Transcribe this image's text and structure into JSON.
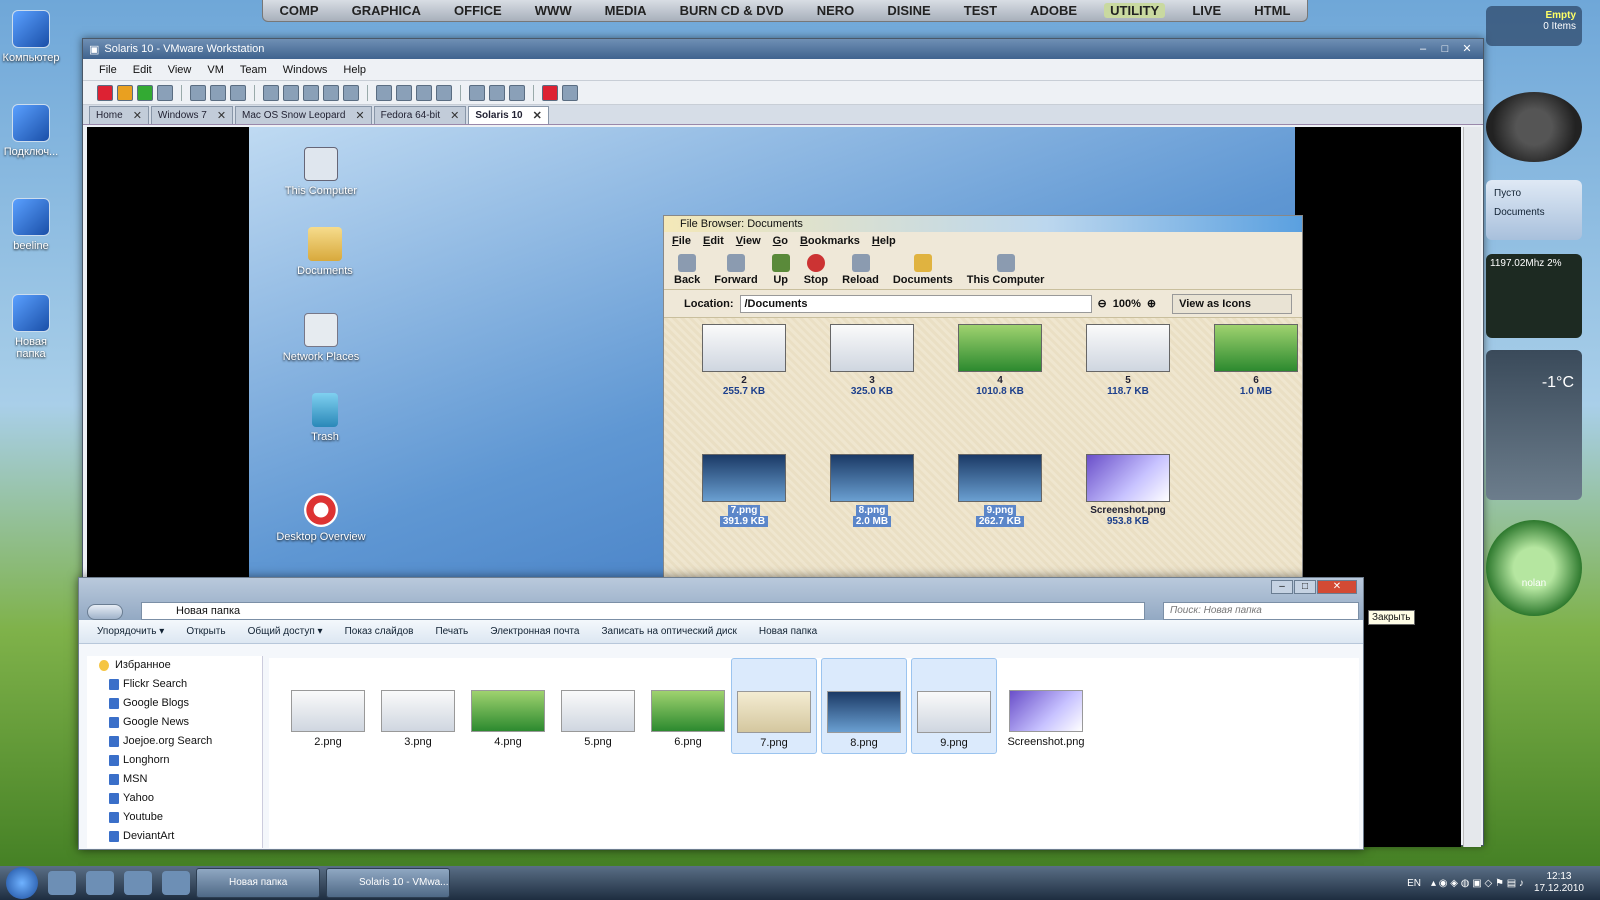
{
  "topbar": [
    "COMP",
    "GRAPHICA",
    "OFFICE",
    "WWW",
    "MEDIA",
    "BURN CD & DVD",
    "NERO",
    "DISINE",
    "TEST",
    "ADOBE",
    "UTILITY",
    "LIVE",
    "HTML"
  ],
  "desktop_icons": [
    "Компьютер",
    "Подключ...",
    "beeline",
    "Новая папка"
  ],
  "vmware": {
    "title": "Solaris 10 - VMware Workstation",
    "menu": [
      "File",
      "Edit",
      "View",
      "VM",
      "Team",
      "Windows",
      "Help"
    ],
    "tabs": [
      "Home",
      "Windows 7",
      "Mac OS Snow Leopard",
      "Fedora 64-bit",
      "Solaris 10"
    ]
  },
  "solaris": {
    "icons": [
      "This Computer",
      "Documents",
      "Network Places",
      "Trash",
      "Desktop Overview"
    ],
    "file_browser": {
      "title": "File Browser: Documents",
      "menu": [
        "File",
        "Edit",
        "View",
        "Go",
        "Bookmarks",
        "Help"
      ],
      "tools": [
        "Back",
        "Forward",
        "Up",
        "Stop",
        "Reload",
        "Documents",
        "This Computer"
      ],
      "location_label": "Location:",
      "location": "/Documents",
      "zoom": "100%",
      "view_as": "View as Icons",
      "files": [
        {
          "name": "2",
          "size": "255.7 KB"
        },
        {
          "name": "3",
          "size": "325.0 KB"
        },
        {
          "name": "4",
          "size": "1010.8 KB"
        },
        {
          "name": "5",
          "size": "118.7 KB"
        },
        {
          "name": "6",
          "size": "1.0 MB"
        },
        {
          "name": "7.png",
          "size": "391.9 KB"
        },
        {
          "name": "8.png",
          "size": "2.0 MB"
        },
        {
          "name": "9.png",
          "size": "262.7 KB"
        },
        {
          "name": "Screenshot.png",
          "size": "953.8 KB"
        }
      ]
    }
  },
  "explorer": {
    "address": "Новая папка",
    "search_placeholder": "Поиск: Новая папка",
    "commands": [
      "Упорядочить ▾",
      "Открыть",
      "Общий доступ ▾",
      "Показ слайдов",
      "Печать",
      "Электронная почта",
      "Записать на оптический диск",
      "Новая папка"
    ],
    "nav": [
      "Избранное",
      "Flickr Search",
      "Google Blogs",
      "Google News",
      "Joejoe.org Search",
      "Longhorn",
      "MSN",
      "Yahoo",
      "Youtube",
      "DeviantArt"
    ],
    "files": [
      "2.png",
      "3.png",
      "4.png",
      "5.png",
      "6.png",
      "7.png",
      "8.png",
      "9.png",
      "Screenshot.png"
    ],
    "close_tooltip": "Закрыть"
  },
  "gadgets": {
    "bin": "Empty",
    "bin_items": "0 Items",
    "note": "Пусто",
    "note2": "Documents",
    "cpu": "1197.02Mhz",
    "cpu_pct": "2%",
    "temp": "-1°C",
    "user": "nolan"
  },
  "taskbar": {
    "tasks": [
      "Новая папка",
      "Solaris 10 - VMwa..."
    ],
    "lang": "EN",
    "time": "12:13",
    "date": "17.12.2010"
  }
}
